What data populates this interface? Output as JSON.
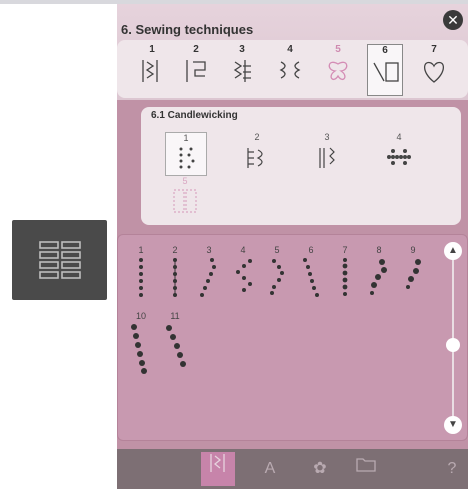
{
  "title": "6. Sewing techniques",
  "categories": [
    {
      "num": "1"
    },
    {
      "num": "2"
    },
    {
      "num": "3"
    },
    {
      "num": "4"
    },
    {
      "num": "5"
    },
    {
      "num": "6"
    },
    {
      "num": "7"
    }
  ],
  "selected_category": "6",
  "subcategory_title": "6.1 Candlewicking",
  "subcategories": [
    {
      "num": "1"
    },
    {
      "num": "2"
    },
    {
      "num": "3"
    },
    {
      "num": "4"
    },
    {
      "num": "5"
    }
  ],
  "stitches": [
    "1",
    "2",
    "3",
    "4",
    "5",
    "6",
    "7",
    "8",
    "9",
    "10",
    "11"
  ],
  "bottom_tabs": [
    "stitch-menu-icon",
    "font-icon",
    "butterfly-icon",
    "folder-icon",
    "help-icon"
  ],
  "help_label": "?",
  "colors": {
    "panel": "#c092a6",
    "accent": "#c784aa",
    "header": "#e6d3dc"
  }
}
